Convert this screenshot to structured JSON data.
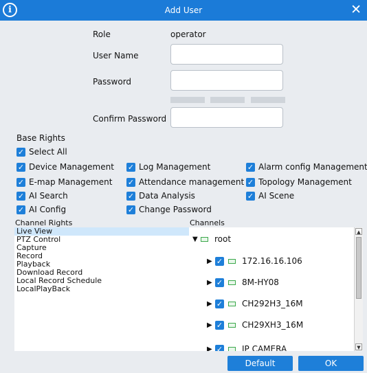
{
  "dialog": {
    "title": "Add User",
    "accent": "#1b7bd8"
  },
  "form": {
    "role_label": "Role",
    "role_value": "operator",
    "username_label": "User Name",
    "username_value": "",
    "password_label": "Password",
    "password_value": "",
    "confirm_label": "Confirm Password",
    "confirm_value": ""
  },
  "base_rights": {
    "heading": "Base Rights",
    "select_all": "Select All",
    "items": [
      "Device Management",
      "Log Management",
      "Alarm config Management",
      "E-map Management",
      "Attendance management",
      "Topology Management",
      "AI Search",
      "Data Analysis",
      "AI Scene",
      "AI Config",
      "Change Password"
    ]
  },
  "channel_rights": {
    "heading": "Channel Rights",
    "items": [
      "Live View",
      "PTZ Control",
      "Capture",
      "Record",
      "Playback",
      "Download Record",
      "Local Record Schedule",
      "LocalPlayBack"
    ],
    "selected": "Live View"
  },
  "channels": {
    "heading": "Channels",
    "root": "root",
    "devices": [
      "172.16.16.106",
      "8M-HY08",
      "CH292H3_16M",
      "CH29XH3_16M",
      "IP CAMERA"
    ]
  },
  "buttons": {
    "default": "Default",
    "ok": "OK"
  }
}
